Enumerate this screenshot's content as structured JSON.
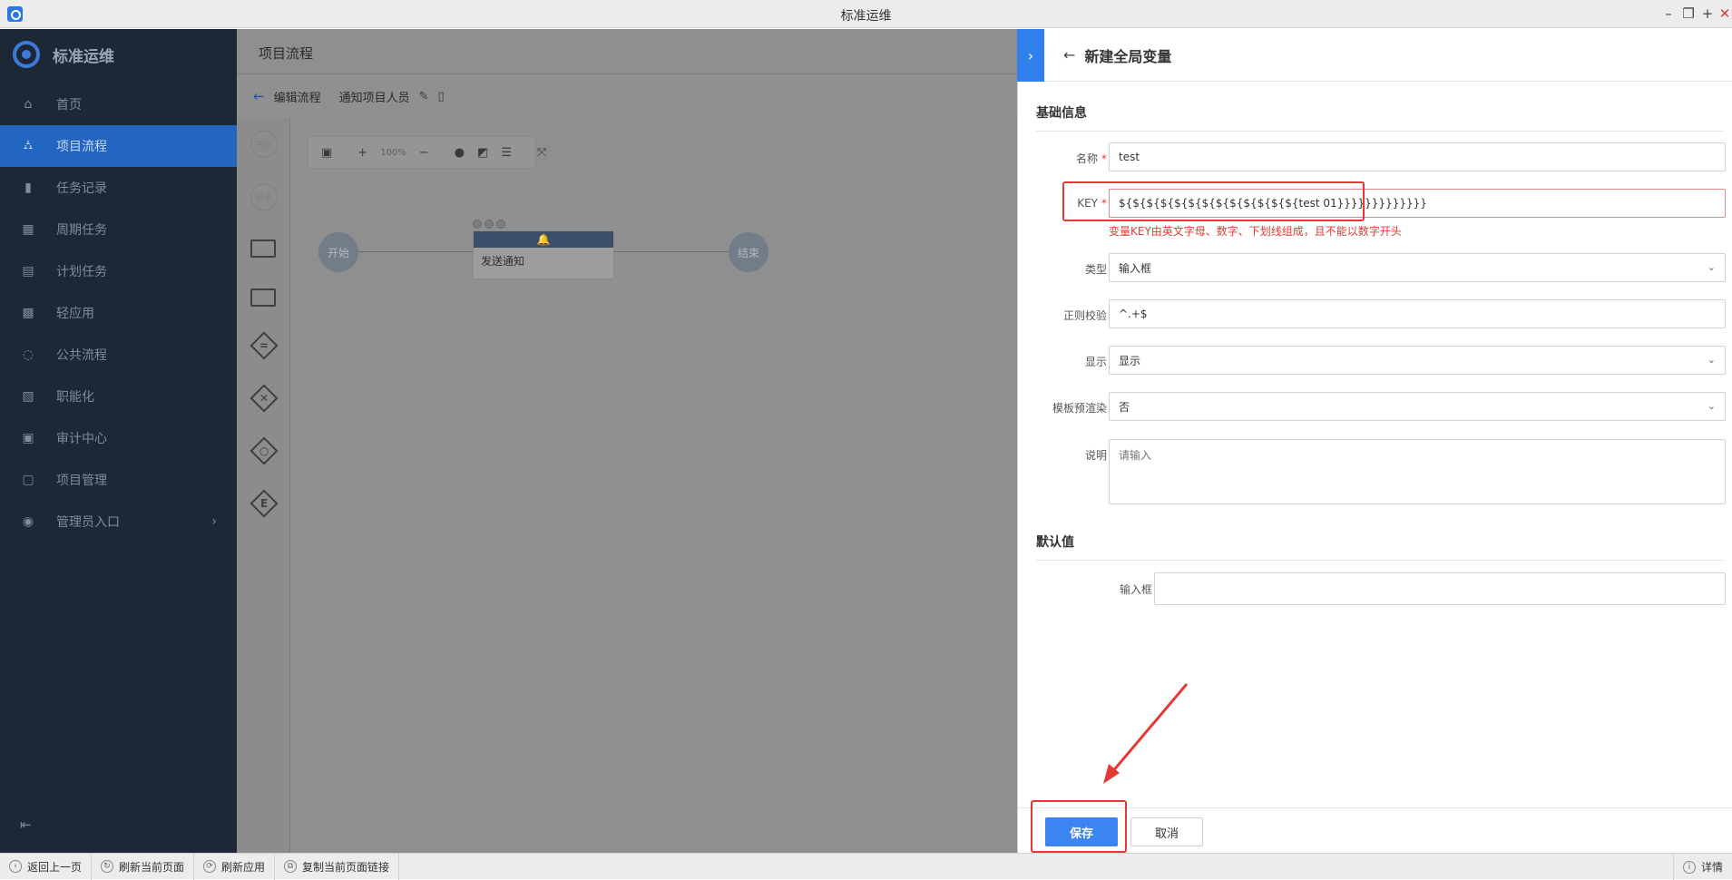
{
  "window": {
    "title": "标准运维"
  },
  "sidebar": {
    "logo_text": "标准运维",
    "items": [
      {
        "label": "首页",
        "icon": "⌂"
      },
      {
        "label": "项目流程",
        "icon": "⛼"
      },
      {
        "label": "任务记录",
        "icon": "▮"
      },
      {
        "label": "周期任务",
        "icon": "▦"
      },
      {
        "label": "计划任务",
        "icon": "▤"
      },
      {
        "label": "轻应用",
        "icon": "▩"
      },
      {
        "label": "公共流程",
        "icon": "◌"
      },
      {
        "label": "职能化",
        "icon": "▧"
      },
      {
        "label": "审计中心",
        "icon": "▣"
      },
      {
        "label": "项目管理",
        "icon": "▢"
      },
      {
        "label": "管理员入口",
        "icon": "◉"
      }
    ],
    "admin_arrow": "›",
    "collapse_glyph": "⇤"
  },
  "main": {
    "page_header": "项目流程",
    "crumb": {
      "back_label": "编辑流程",
      "flow_name": "通知项目人员"
    },
    "palette": {
      "start": "开始",
      "end": "结束"
    },
    "toolbar": {
      "zoom": "100%",
      "plus": "+",
      "minus": "−"
    },
    "nodes": {
      "start": "开始",
      "end": "结束",
      "task": "发送通知"
    }
  },
  "drawer": {
    "title": "新建全局变量",
    "basic_section": "基础信息",
    "fields": {
      "name": {
        "label": "名称",
        "value": "test"
      },
      "key": {
        "label": "KEY",
        "value": "${${${${${${${${${${${${${test 01}}}}}}}}}}}}}",
        "error": "变量KEY由英文字母、数字、下划线组成，且不能以数字开头"
      },
      "type": {
        "label": "类型",
        "value": "输入框"
      },
      "regex": {
        "label": "正则校验",
        "value": "^.+$"
      },
      "display": {
        "label": "显示",
        "value": "显示"
      },
      "prerender": {
        "label": "模板预渲染",
        "value": "否"
      },
      "desc": {
        "label": "说明",
        "placeholder": "请输入"
      }
    },
    "default_section": "默认值",
    "default_field": {
      "label": "输入框",
      "value": ""
    },
    "required_mark": "*",
    "save_label": "保存",
    "cancel_label": "取消"
  },
  "bottombar": {
    "items": [
      "返回上一页",
      "刷新当前页面",
      "刷新应用",
      "复制当前页面链接"
    ],
    "right_label": "详情"
  },
  "colors": {
    "accent": "#3a85f0",
    "sidebar_bg": "#1e2736",
    "error": "#e53935"
  }
}
